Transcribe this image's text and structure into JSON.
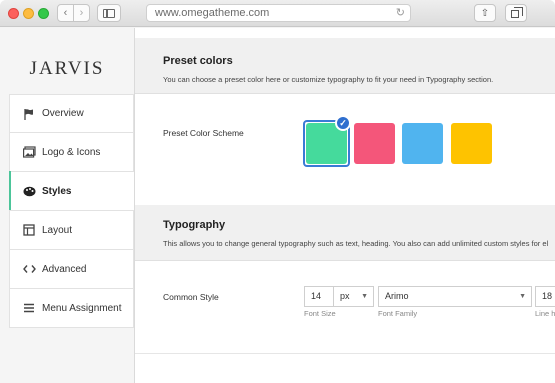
{
  "browser": {
    "url": "www.omegatheme.com"
  },
  "sidebar": {
    "brand": "JARVIS",
    "items": [
      {
        "label": "Overview",
        "icon": "flag-icon"
      },
      {
        "label": "Logo & Icons",
        "icon": "image-icon"
      },
      {
        "label": "Styles",
        "icon": "palette-icon"
      },
      {
        "label": "Layout",
        "icon": "layout-icon"
      },
      {
        "label": "Advanced",
        "icon": "code-icon"
      },
      {
        "label": "Menu Assignment",
        "icon": "menu-icon"
      }
    ],
    "active": "Styles"
  },
  "preset": {
    "title": "Preset colors",
    "description": "You can choose a preset color here or customize typography to fit your need in Typography section.",
    "field_label": "Preset Color Scheme",
    "swatches": [
      "#45da9c",
      "#f4567a",
      "#50b4ef",
      "#fec300"
    ],
    "selected": "#45da9c"
  },
  "typography": {
    "title": "Typography",
    "description": "This allows you to change general typography such as text, heading. You also can add unlimited custom styles for el",
    "common_label": "Common Style",
    "font_size": "14",
    "unit": "px",
    "font_family": "Arimo",
    "line_height": "18",
    "hint_size": "Font Size",
    "hint_family": "Font Family",
    "hint_lh": "Line h"
  }
}
